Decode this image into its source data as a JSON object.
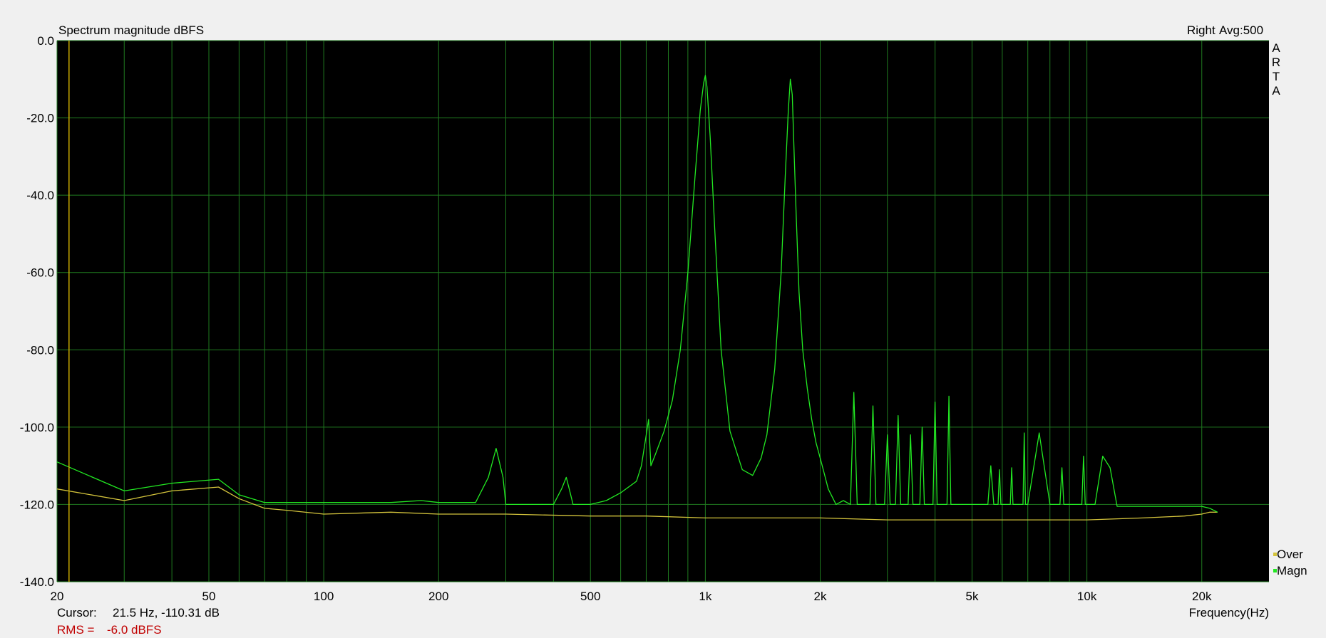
{
  "chart_data": {
    "type": "line",
    "title": "Spectrum magnitude dBFS",
    "channel": "Right",
    "avg": "Avg:500",
    "brand": "ARTA",
    "xlabel": "Frequency(Hz)",
    "ylabel": "",
    "x_scale": "log",
    "xlim": [
      20,
      30000
    ],
    "ylim": [
      -140,
      0
    ],
    "grid": true,
    "background": "#000000",
    "y_ticks": [
      0,
      -20,
      -40,
      -60,
      -80,
      -100,
      -120,
      -140
    ],
    "y_tick_labels": [
      "0.0",
      "-20.0",
      "-40.0",
      "-60.0",
      "-80.0",
      "-100.0",
      "-120.0",
      "-140.0"
    ],
    "x_tick_values": [
      20,
      50,
      100,
      200,
      500,
      1000,
      2000,
      5000,
      10000,
      20000
    ],
    "x_tick_labels": [
      "20",
      "50",
      "100",
      "200",
      "500",
      "1k",
      "2k",
      "5k",
      "10k",
      "20k"
    ],
    "cursor_x": 21.5,
    "legend_placement": "bottom-right",
    "series": [
      {
        "name": "Magn",
        "color": "#22e822",
        "x": [
          20,
          30,
          40,
          53,
          60,
          70,
          80,
          100,
          150,
          180,
          200,
          250,
          270,
          283,
          295,
          300,
          320,
          350,
          400,
          420,
          432,
          440,
          450,
          500,
          550,
          600,
          660,
          680,
          700,
          710,
          720,
          740,
          780,
          820,
          860,
          900,
          940,
          970,
          990,
          1000,
          1010,
          1030,
          1060,
          1100,
          1160,
          1250,
          1330,
          1400,
          1450,
          1520,
          1580,
          1620,
          1650,
          1670,
          1690,
          1700,
          1710,
          1730,
          1760,
          1800,
          1850,
          1900,
          1950,
          2000,
          2050,
          2100,
          2200,
          2300,
          2400,
          2450,
          2500,
          2550,
          2700,
          2750,
          2800,
          2950,
          3000,
          3050,
          3150,
          3200,
          3250,
          3400,
          3450,
          3500,
          3650,
          3700,
          3750,
          3950,
          4000,
          4050,
          4300,
          4350,
          4400,
          5000,
          5500,
          5600,
          5700,
          5850,
          5900,
          5950,
          6300,
          6350,
          6400,
          6800,
          6850,
          6900,
          7000,
          7500,
          8000,
          8500,
          8600,
          8700,
          9700,
          9800,
          9900,
          10500,
          11000,
          11500,
          12000,
          13000,
          14000,
          15000,
          16000,
          17000,
          18000,
          19000,
          20000,
          21000,
          22000
        ],
        "y": [
          -109,
          -116.5,
          -114.5,
          -113.5,
          -117.5,
          -119.5,
          -119.5,
          -119.5,
          -119.5,
          -119,
          -119.5,
          -119.5,
          -113,
          -105.5,
          -113,
          -120,
          -120,
          -120,
          -120,
          -116,
          -113,
          -116,
          -120,
          -120,
          -119,
          -117,
          -114,
          -110,
          -102,
          -98,
          -110,
          -107,
          -101,
          -93,
          -80,
          -60,
          -35,
          -18,
          -11,
          -9,
          -12,
          -25,
          -50,
          -80,
          -101,
          -111,
          -112.5,
          -108,
          -102,
          -85,
          -60,
          -35,
          -18,
          -10,
          -14,
          -22,
          -30,
          -45,
          -65,
          -80,
          -90,
          -98,
          -104,
          -108,
          -112,
          -116,
          -120,
          -119,
          -120,
          -91,
          -120,
          -120,
          -120,
          -94.5,
          -120,
          -120,
          -102,
          -120,
          -120,
          -97,
          -120,
          -120,
          -102,
          -120,
          -120,
          -100,
          -120,
          -120,
          -93.5,
          -120,
          -120,
          -92,
          -120,
          -120,
          -120,
          -110,
          -120,
          -120,
          -111,
          -120,
          -120,
          -110.5,
          -120,
          -120,
          -101.5,
          -120,
          -120,
          -101.5,
          -120,
          -120,
          -110.5,
          -120,
          -120,
          -107.5,
          -120,
          -120,
          -107.5,
          -110.5,
          -120.5,
          -120.5,
          -120.5,
          -120.5,
          -120.5,
          -120.5,
          -120.5,
          -120.5,
          -120.5,
          -121,
          -122
        ]
      },
      {
        "name": "Over",
        "color": "#d4c43c",
        "x": [
          20,
          30,
          40,
          53,
          60,
          70,
          80,
          100,
          150,
          200,
          300,
          500,
          700,
          1000,
          1500,
          2000,
          3000,
          5000,
          8000,
          10000,
          14000,
          18000,
          20000,
          21000,
          22000
        ],
        "y": [
          -116,
          -119,
          -116.5,
          -115.5,
          -118.5,
          -121,
          -121.5,
          -122.5,
          -122,
          -122.5,
          -122.5,
          -123,
          -123,
          -123.5,
          -123.5,
          -123.5,
          -124,
          -124,
          -124,
          -124,
          -123.5,
          -123,
          -122.5,
          -122,
          -122
        ]
      }
    ]
  },
  "cursor": {
    "label": "Cursor:",
    "value": "21.5 Hz, -110.31 dB"
  },
  "rms": {
    "label": "RMS =",
    "value": "-6.0 dBFS"
  }
}
